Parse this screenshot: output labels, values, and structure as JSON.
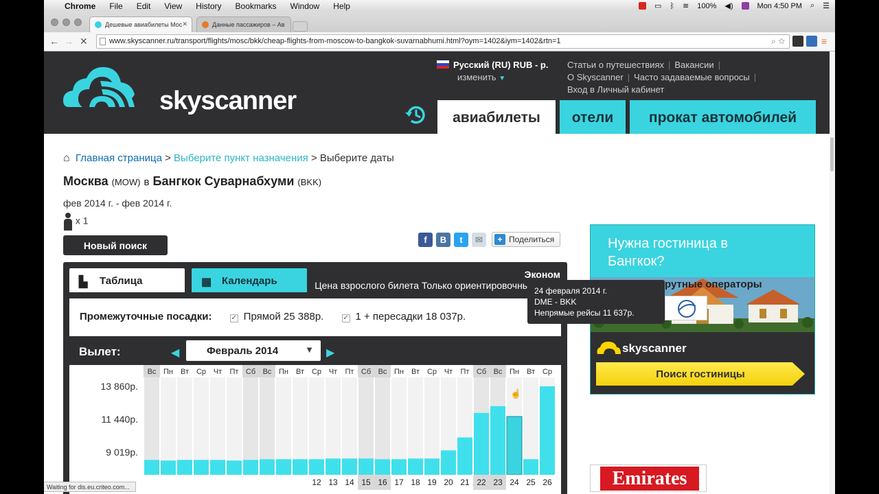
{
  "menubar": {
    "app": "Chrome",
    "items": [
      "File",
      "Edit",
      "View",
      "History",
      "Bookmarks",
      "Window",
      "Help"
    ],
    "battery": "100%",
    "clock": "Mon 4:50 PM"
  },
  "browser": {
    "tabs": [
      {
        "title": "Дешевые авиабилеты Мос",
        "active": true
      },
      {
        "title": "Данные пассажиров – Ав",
        "active": false
      }
    ],
    "url": "www.skyscanner.ru/transport/flights/mosc/bkk/cheap-flights-from-moscow-to-bangkok-suvarnabhumi.html?oym=1402&iym=1402&rtn=1",
    "status": "Waiting for dis.eu.criteo.com..."
  },
  "header": {
    "logo": "skyscanner",
    "language": "Русский (RU) RUB - р.",
    "change": "изменить",
    "links_row1": [
      "Статьи о путешествиях",
      "Вакансии"
    ],
    "links_row2": [
      "О Skyscanner",
      "Часто задаваемые вопросы"
    ],
    "links_row3": [
      "Вход в Личный кабинет"
    ],
    "tabs": {
      "flights": "авиабилеты",
      "hotels": "отели",
      "cars": "прокат автомобилей"
    }
  },
  "breadcrumb": {
    "home": "Главная страница",
    "sep": ">",
    "destination": "Выберите пункт назначения",
    "current": "Выберите даты"
  },
  "route": {
    "from": "Москва",
    "from_code": "(MOW)",
    "in": "в",
    "to": "Бангкок Суварнабхуми",
    "to_code": "(BKK)",
    "dates": "фев 2014 г. - фев 2014 г.",
    "passengers": "x 1"
  },
  "actions": {
    "new_search": "Новый поиск",
    "share": "Поделиться"
  },
  "panel": {
    "tab_table": "Таблица",
    "tab_calendar": "Календарь",
    "class": "Эконом",
    "note": "Цена взрослого билета Только ориентировочные цены",
    "stops_label": "Промежуточные посадки:",
    "direct": "Прямой 25 388р.",
    "connecting": "1 + пересадки 18 037р.",
    "departure_label": "Вылет:",
    "month": "Февраль 2014"
  },
  "chart_data": {
    "type": "bar",
    "y_tick_labels": [
      "13 860р.",
      "11 440р.",
      "9 019р."
    ],
    "y_ticks": [
      13860,
      11440,
      9019
    ],
    "weekdays": [
      "Вс",
      "Пн",
      "Вт",
      "Ср",
      "Чт",
      "Пт",
      "Сб",
      "Вс",
      "Пн",
      "Вт",
      "Ср",
      "Чт",
      "Пт",
      "Сб",
      "Вс",
      "Пн",
      "Вт",
      "Ср",
      "Чт",
      "Пт",
      "Сб",
      "Вс",
      "Пн",
      "Вт",
      "Ср"
    ],
    "days": [
      "",
      "",
      "",
      "",
      "",
      "",
      "",
      "",
      "",
      "",
      "12",
      "13",
      "14",
      "15",
      "16",
      "17",
      "18",
      "19",
      "20",
      "21",
      "22",
      "23",
      "24",
      "25",
      "26"
    ],
    "weekend_flags": [
      1,
      0,
      0,
      0,
      0,
      0,
      1,
      1,
      0,
      0,
      0,
      0,
      0,
      1,
      1,
      0,
      0,
      0,
      0,
      0,
      1,
      1,
      0,
      0,
      0
    ],
    "values": [
      8450,
      8400,
      8450,
      8450,
      8450,
      8400,
      8450,
      8500,
      8500,
      8500,
      8500,
      8550,
      8550,
      8550,
      8500,
      8500,
      8550,
      8550,
      9150,
      10100,
      11900,
      12400,
      11637,
      8500,
      13860
    ],
    "highlighted_index": 22
  },
  "tooltip": {
    "date": "24 февраля 2014 г.",
    "route": "DME - BKK",
    "price": "Непрямые рейсы 11 637р."
  },
  "ad": {
    "title": "Нужна гостиница в Бангкок?",
    "logo": "skyscanner",
    "button": "Поиск гостиницы"
  },
  "operators": {
    "title_visible": "рутные операторы",
    "airline": "Emirates"
  }
}
